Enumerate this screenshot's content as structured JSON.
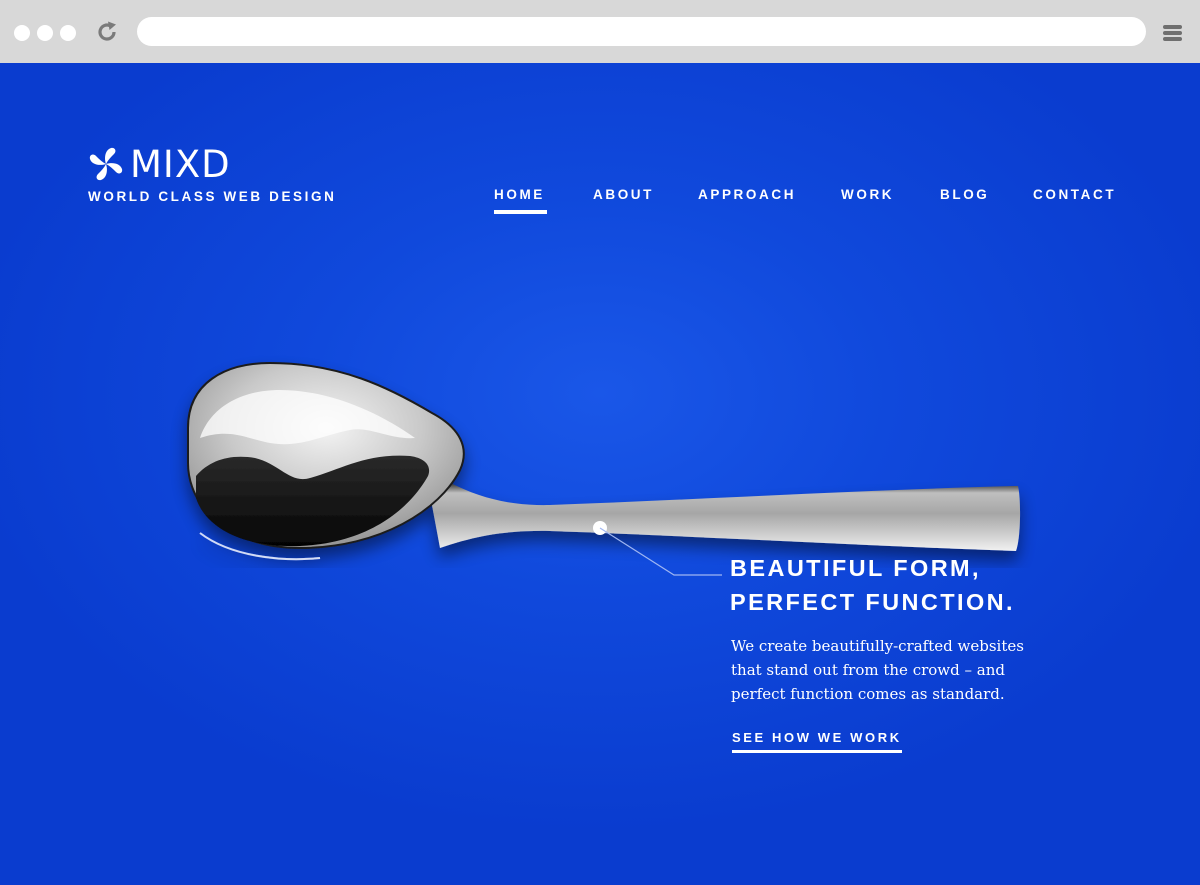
{
  "browser": {
    "window_buttons": [
      "close",
      "minimize",
      "maximize"
    ],
    "reload_icon": "reload-icon",
    "address_value": "",
    "menu_icon": "hamburger-menu-icon"
  },
  "brand": {
    "name": "MIXD",
    "tagline": "WORLD CLASS WEB DESIGN",
    "logo_icon": "pinwheel-logo-icon"
  },
  "nav": {
    "items": [
      {
        "label": "HOME",
        "active": true
      },
      {
        "label": "ABOUT",
        "active": false
      },
      {
        "label": "APPROACH",
        "active": false
      },
      {
        "label": "WORK",
        "active": false
      },
      {
        "label": "BLOG",
        "active": false
      },
      {
        "label": "CONTACT",
        "active": false
      }
    ]
  },
  "hero": {
    "image": "spoon-illustration",
    "headline_line1": "BEAUTIFUL FORM,",
    "headline_line2": "PERFECT FUNCTION.",
    "body": "We create beautifully-crafted websites that stand out from the crowd – and perfect function comes as standard.",
    "cta_label": "SEE HOW WE WORK"
  },
  "colors": {
    "background": "#1049dc",
    "text": "#ffffff",
    "chrome": "#d8d8d8"
  }
}
